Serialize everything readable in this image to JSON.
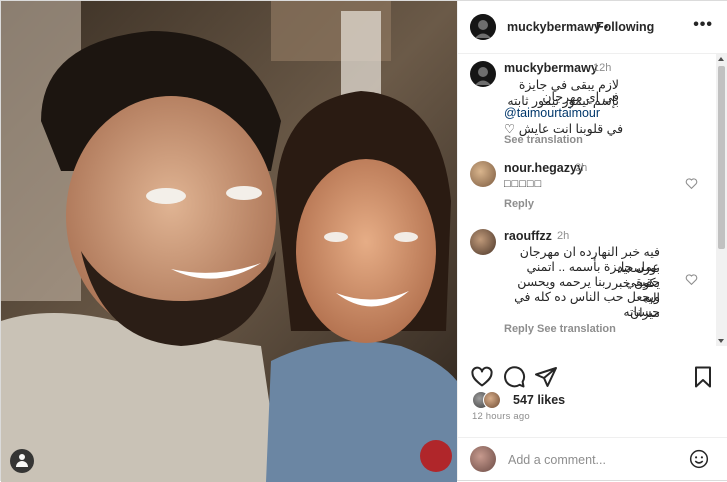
{
  "post": {
    "author": "muckybermawy",
    "separator": "•",
    "follow_status": "Following",
    "more": "•••"
  },
  "comments": [
    {
      "user": "muckybermawy",
      "time": "12h",
      "lines": [
        "لازم يبقى في جايزة بإسم تيمور تيمور ثابته",
        "في اي مهرجان"
      ],
      "mention": "@taimourtaimour",
      "last_line": "في قلوبنا انت عايش",
      "see_translation": "See translation"
    },
    {
      "user": "nour.hegazyy",
      "time": "2h",
      "text": "□□□□□",
      "reply": "Reply"
    },
    {
      "user": "raouffzz",
      "time": "2h",
      "lines": [
        "فيه خبر النهارده ان مهرجان بورسعيد",
        "عمل جايزة بأسمه .. اتمني يكون خبر",
        "حقيقي .. ربنا يرحمه ويحسن اليه",
        "ويجعل حب الناس ده كله في ميزان",
        "حسناته"
      ],
      "reply": "Reply",
      "see_translation": "See translation"
    }
  ],
  "likes": "547 likes",
  "time_ago": "12 hours ago",
  "add_comment_placeholder": "Add a comment...",
  "icons": {
    "like": "heart-icon",
    "comment": "comment-icon",
    "share": "share-icon",
    "save": "bookmark-icon",
    "emoji": "emoji-icon",
    "user_tag": "user-icon"
  },
  "colors": {
    "text": "#262626",
    "secondary": "#8e8e8e",
    "link": "#00376b",
    "border": "#efefef"
  }
}
